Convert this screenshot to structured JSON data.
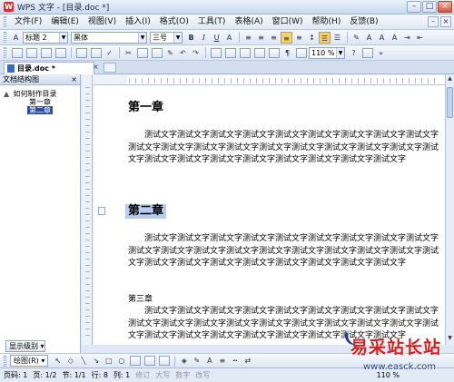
{
  "window": {
    "title": "WPS 文字 - [目录.doc *]",
    "logo": "W",
    "min": "–",
    "max": "□",
    "close": "×"
  },
  "menu": [
    "文件(F)",
    "编辑(E)",
    "视图(V)",
    "插入(I)",
    "格式(O)",
    "工具(T)",
    "表格(A)",
    "窗口(W)",
    "帮助(H)",
    "反馈(B)"
  ],
  "toolbar": {
    "style_value": "标题 2",
    "font_value": "黑体",
    "size_value": "三号",
    "zoom_value": "110 %"
  },
  "tab": {
    "name": "目录.doc *",
    "close": "×"
  },
  "sidebar": {
    "title": "文档结构图",
    "close": "×",
    "root": "如何制作目录",
    "root_toggle": "▲",
    "items": [
      "第一章",
      "第二章"
    ],
    "footer": "显示级别 ▾"
  },
  "document": {
    "h1": "第一章",
    "p1": "测试文字测试文字测试文字测试文字测试文字测试文字测试文字测试文字测试文字测试文字测试文字测试文字测试文字测试文字测试文字测试文字测试文字测试文字测试文字测试文字测试文字测试文字测试文字测试文字测试文字测试文字测试文字",
    "h2": "第二章",
    "p2": "测试文字测试文字测试文字测试文字测试文字测试文字测试文字测试文字测试文字测试文字测试文字测试文字测试文字测试文字测试文字测试文字测试文字测试文字测试文字测试文字测试文字测试文字测试文字测试文字测试文字测试文字测试文字",
    "h3": "第三章",
    "p3": "测试文字测试文字测试文字测试文字测试文字测试文字测试文字测试文字测试文字测试文字测试文字测试文字测试文字测试文字测试文字测试文字测试文字测试文字测试文字测试文字测试文字测试文字测试文字测试文字测试文字测试文字测试文字"
  },
  "drawbar": {
    "label": "绘图(R) ▾"
  },
  "status": {
    "page": "页码: 1",
    "pages": "页: 1/2",
    "section": "节: 1/1",
    "row": "行: 8",
    "col": "列: 1",
    "rev": "修订",
    "caps": "大写",
    "num": "数字",
    "ovr": "改写",
    "zoom": "110 %"
  },
  "watermark": {
    "text": "易采站长站",
    "url": "www.easck.com"
  }
}
